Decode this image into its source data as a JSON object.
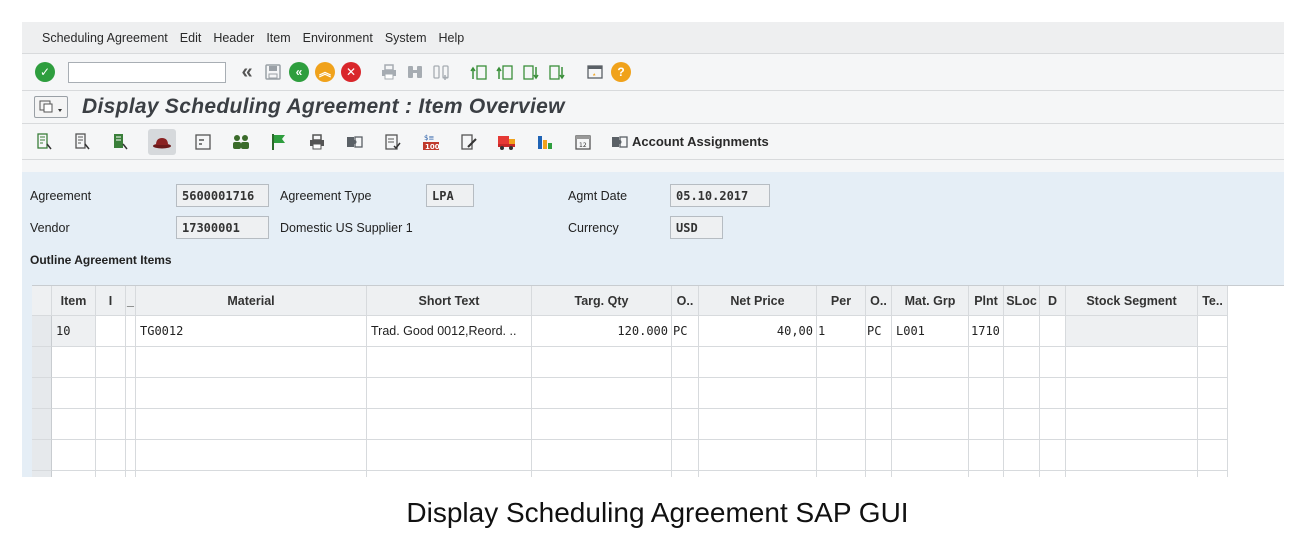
{
  "menu": [
    "Scheduling Agreement",
    "Edit",
    "Header",
    "Item",
    "Environment",
    "System",
    "Help"
  ],
  "command_field": {
    "value": ""
  },
  "title": "Display Scheduling Agreement : Item Overview",
  "app_toolbar": {
    "account_assignments_label": "Account Assignments"
  },
  "header": {
    "agreement_label": "Agreement",
    "agreement_value": "5600001716",
    "agreement_type_label": "Agreement Type",
    "agreement_type_value": "LPA",
    "agmt_date_label": "Agmt Date",
    "agmt_date_value": "05.10.2017",
    "vendor_label": "Vendor",
    "vendor_value": "17300001",
    "vendor_name": "Domestic US Supplier 1",
    "currency_label": "Currency",
    "currency_value": "USD",
    "section_label": "Outline Agreement Items"
  },
  "table": {
    "columns": [
      "Item",
      "I",
      "_",
      "Material",
      "Short Text",
      "Targ. Qty",
      "O..",
      "Net Price",
      "Per",
      "O..",
      "Mat. Grp",
      "Plnt",
      "SLoc",
      "D",
      "Stock Segment",
      "Te.."
    ],
    "rows": [
      [
        "10",
        "",
        "",
        "TG0012",
        "Trad. Good 0012,Reord. ..",
        "120.000",
        "PC",
        "40,00",
        "1",
        "PC",
        "L001",
        "1710",
        "",
        "",
        "",
        ""
      ]
    ]
  },
  "caption": "Display Scheduling Agreement SAP GUI",
  "colors": {
    "green": "#2e9e3e",
    "orange": "#f0a21b",
    "red": "#d9262b",
    "accent": "#3b3f44"
  },
  "icons": [
    "check-icon",
    "back-icon",
    "save-icon",
    "exit-icon",
    "cancel-icon",
    "print-icon",
    "find-icon",
    "help-icon",
    "account-assignment-icon"
  ]
}
